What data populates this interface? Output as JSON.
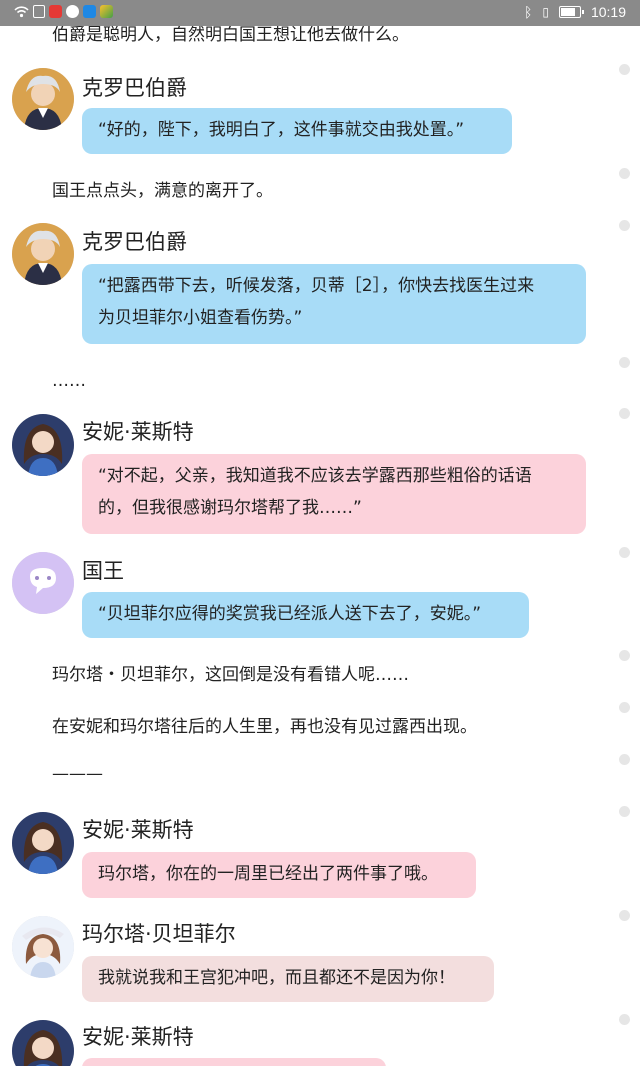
{
  "status_bar": {
    "time": "10:19",
    "battery_level": 0.85
  },
  "texts": {
    "top_line": "伯爵是聪明人，自然明白国王想让他去做什么。",
    "n1": "国王点点头，满意的离开了。",
    "ellipsis": "……",
    "n2": "玛尔塔・贝坦菲尔，这回倒是没有看错人呢……",
    "n3": "在安妮和玛尔塔往后的人生里，再也没有见过露西出现。",
    "divider": "———"
  },
  "messages": [
    {
      "speaker": "克罗巴伯爵",
      "text": "“好的，陛下，我明白了，这件事就交由我处置。”",
      "bubble_color": "#a8dcf7"
    },
    {
      "speaker": "克罗巴伯爵",
      "line1": "“把露西带下去，听候发落，贝蒂［2］，你快去找医生过来",
      "line2": "为贝坦菲尔小姐查看伤势。”",
      "bubble_color": "#a8dcf7"
    },
    {
      "speaker": "安妮·莱斯特",
      "line1": "“对不起，父亲，我知道我不应该去学露西那些粗俗的话语",
      "line2": "的，但我很感谢玛尔塔帮了我……”",
      "bubble_color": "#fcd2db"
    },
    {
      "speaker": "国王",
      "text": "“贝坦菲尔应得的奖赏我已经派人送下去了，安妮。”",
      "bubble_color": "#a8dcf7"
    },
    {
      "speaker": "安妮·莱斯特",
      "text": "玛尔塔，你在的一周里已经出了两件事了哦。",
      "bubble_color": "#fcd2db"
    },
    {
      "speaker": "玛尔塔·贝坦菲尔",
      "text": "我就说我和王宫犯冲吧，而且都还不是因为你！",
      "bubble_color": "#f3dede"
    },
    {
      "speaker": "安妮·莱斯特",
      "text": "",
      "bubble_color": "#fcd2db"
    }
  ]
}
